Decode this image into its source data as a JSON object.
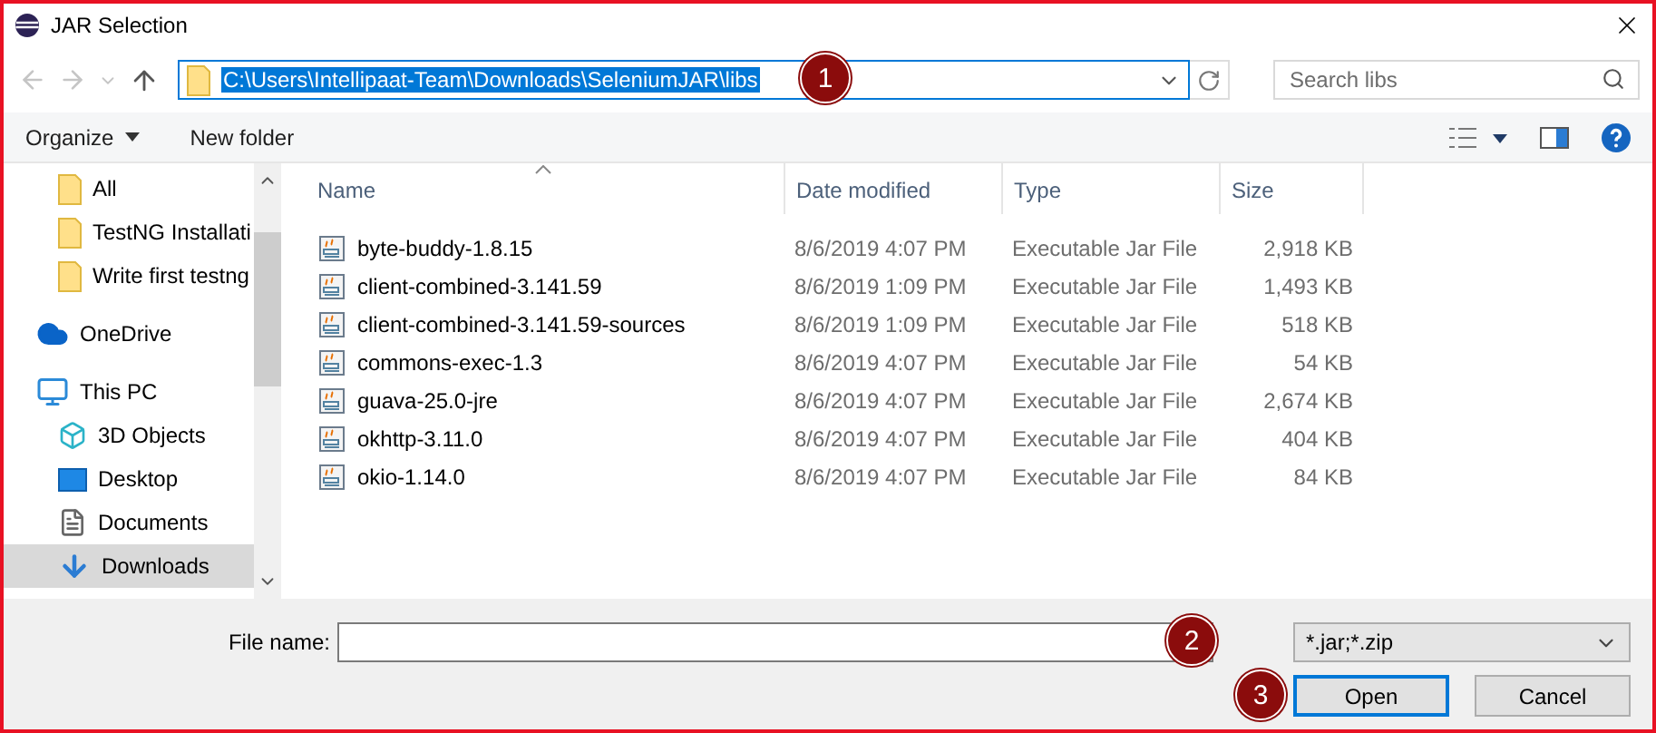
{
  "window": {
    "title": "JAR Selection"
  },
  "address": {
    "path": "C:\\Users\\Intellipaat-Team\\Downloads\\SeleniumJAR\\libs",
    "selected": true
  },
  "search": {
    "placeholder": "Search libs"
  },
  "toolbar": {
    "organize": "Organize",
    "new_folder": "New folder"
  },
  "sidebar": {
    "items": [
      {
        "kind": "folder",
        "label": "All",
        "selected": false
      },
      {
        "kind": "folder",
        "label": "TestNG Installati",
        "selected": false
      },
      {
        "kind": "folder",
        "label": "Write first testng",
        "selected": false
      },
      {
        "kind": "cloud",
        "label": "OneDrive",
        "selected": false
      },
      {
        "kind": "computer",
        "label": "This PC",
        "selected": false,
        "children": [
          {
            "kind": "cube",
            "label": "3D Objects",
            "selected": false
          },
          {
            "kind": "desktop",
            "label": "Desktop",
            "selected": false
          },
          {
            "kind": "documents",
            "label": "Documents",
            "selected": false
          },
          {
            "kind": "downloads",
            "label": "Downloads",
            "selected": true
          }
        ]
      }
    ]
  },
  "table": {
    "columns": [
      "Name",
      "Date modified",
      "Type",
      "Size"
    ],
    "rows": [
      {
        "name": "byte-buddy-1.8.15",
        "date": "8/6/2019 4:07 PM",
        "type": "Executable Jar File",
        "size": "2,918 KB"
      },
      {
        "name": "client-combined-3.141.59",
        "date": "8/6/2019 1:09 PM",
        "type": "Executable Jar File",
        "size": "1,493 KB"
      },
      {
        "name": "client-combined-3.141.59-sources",
        "date": "8/6/2019 1:09 PM",
        "type": "Executable Jar File",
        "size": "518 KB"
      },
      {
        "name": "commons-exec-1.3",
        "date": "8/6/2019 4:07 PM",
        "type": "Executable Jar File",
        "size": "54 KB"
      },
      {
        "name": "guava-25.0-jre",
        "date": "8/6/2019 4:07 PM",
        "type": "Executable Jar File",
        "size": "2,674 KB"
      },
      {
        "name": "okhttp-3.11.0",
        "date": "8/6/2019 4:07 PM",
        "type": "Executable Jar File",
        "size": "404 KB"
      },
      {
        "name": "okio-1.14.0",
        "date": "8/6/2019 4:07 PM",
        "type": "Executable Jar File",
        "size": "84 KB"
      }
    ]
  },
  "file_name": {
    "label": "File name:"
  },
  "filter": {
    "value": "*.jar;*.zip"
  },
  "buttons": [
    {
      "label": "Open",
      "default": true
    },
    {
      "label": "Cancel",
      "default": false
    }
  ],
  "callouts": [
    "1",
    "2",
    "3"
  ]
}
